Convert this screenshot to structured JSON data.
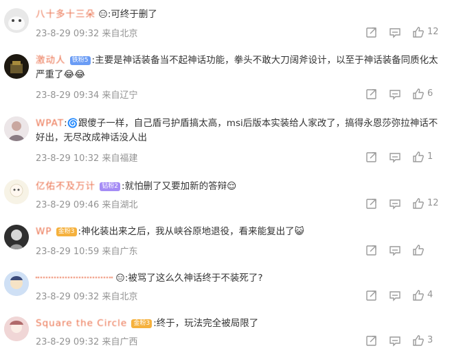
{
  "comments": [
    {
      "nickname": "八十多十三朵",
      "badge": "",
      "prefix_emoji": "😑",
      "text": ":可终于删了",
      "date": "23-8-29 09:32",
      "location": "来自北京",
      "likes": "12",
      "avatar_color": "#e8e8e8"
    },
    {
      "nickname": "激动人",
      "badge": "铁粉5",
      "prefix_emoji": "",
      "text": ":主要是神话装备当不起神话功能，拳头不敢大刀阔斧设计，以至于神话装备同质化太严重了😂😂",
      "date": "23-8-29 09:34",
      "location": "来自辽宁",
      "likes": "6",
      "avatar_color": "#2b2418"
    },
    {
      "nickname": "WPAT",
      "badge": "",
      "prefix_emoji": "🌀",
      "text": "跟傻子一样，自己盾弓护盾搞太高，msi后版本实装给人家改了，搞得永恩莎弥拉神话不好出，无尽改成神话没人出",
      "date": "23-8-29 10:32",
      "location": "来自福建",
      "likes": "1",
      "avatar_color": "#d9cfd2"
    },
    {
      "nickname": "亿佑不及万计",
      "badge": "钻粉2",
      "prefix_emoji": "",
      "text": ":就怕删了又要加新的答辩😌",
      "date": "23-8-29 09:46",
      "location": "来自湖北",
      "likes": "12",
      "avatar_color": "#f3efe2"
    },
    {
      "nickname": "WP",
      "badge": "金粉3",
      "prefix_emoji": "",
      "text": ":神化装出来之后，我从峡谷原地退役，看来能复出了😺",
      "date": "23-8-29 10:59",
      "location": "来自广东",
      "likes": "",
      "avatar_color": "#3a3a3a"
    },
    {
      "nickname": "",
      "badge": "",
      "prefix_emoji": "😑",
      "text": ":被骂了这么久神话终于不装死了?",
      "date": "23-8-29 09:32",
      "location": "来自北京",
      "likes": "4",
      "avatar_color": "#c8d9ef"
    },
    {
      "nickname": "Square the Circle",
      "badge": "金粉3",
      "prefix_emoji": "",
      "text": ":终于，玩法完全被局限了",
      "date": "23-8-29 09:32",
      "location": "来自广西",
      "likes": "3",
      "avatar_color": "#e9c9c9"
    }
  ]
}
